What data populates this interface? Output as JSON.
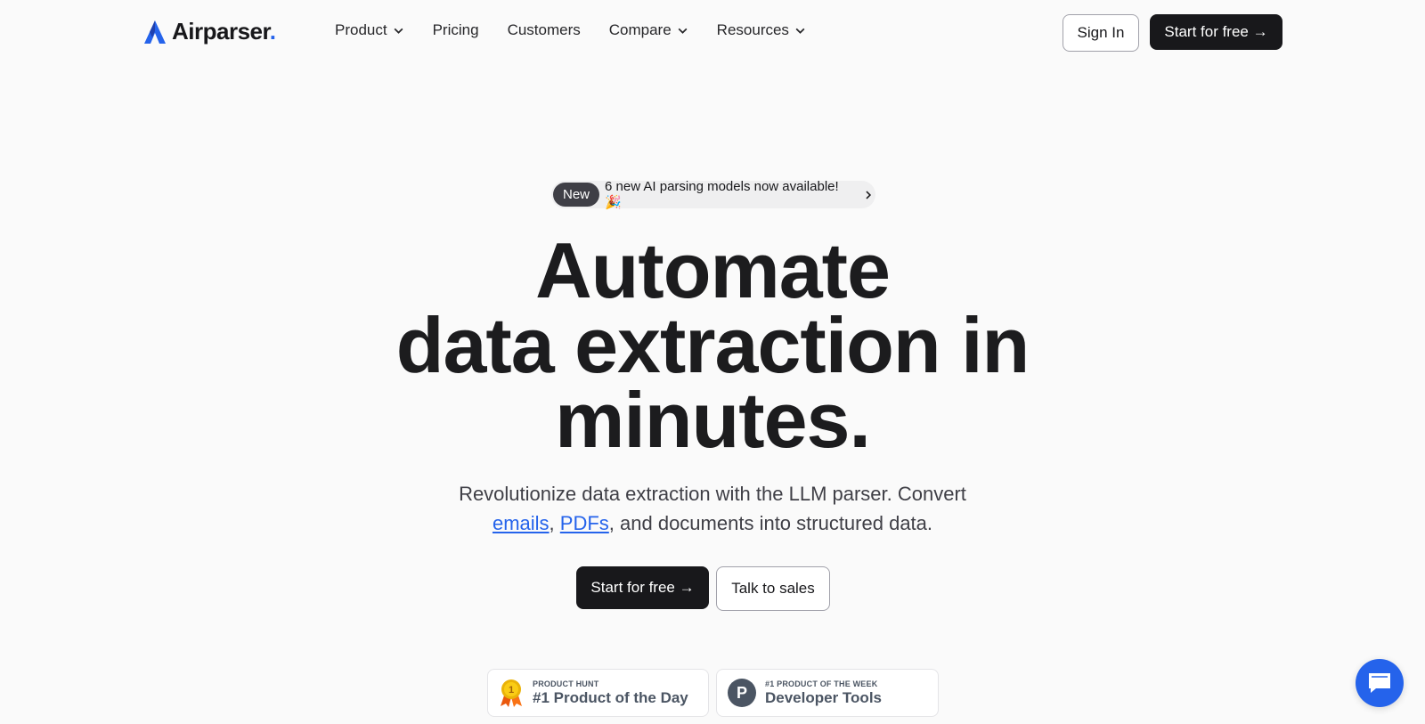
{
  "nav": {
    "logo_text": "Airparser",
    "logo_dot": ".",
    "items": [
      {
        "label": "Product",
        "has_dropdown": true
      },
      {
        "label": "Pricing",
        "has_dropdown": false
      },
      {
        "label": "Customers",
        "has_dropdown": false
      },
      {
        "label": "Compare",
        "has_dropdown": true
      },
      {
        "label": "Resources",
        "has_dropdown": true
      }
    ],
    "sign_in": "Sign In",
    "start_free": "Start for free →"
  },
  "announcement": {
    "badge": "New",
    "text": "6 new AI parsing models now available! 🎉"
  },
  "hero": {
    "line1": "Automate",
    "line2": "data extraction in",
    "line3": "minutes.",
    "subtitle_before": "Revolutionize data extraction with the LLM parser. Convert",
    "link_emails": "emails",
    "comma": ",",
    "link_pdfs": "PDFs",
    "subtitle_after": ", and documents into structured data.",
    "cta_primary": "Start for free →",
    "cta_secondary": "Talk to sales"
  },
  "badges": {
    "product_hunt": {
      "small": "PRODUCT HUNT",
      "big": "#1 Product of the Day",
      "medal_number": "1"
    },
    "dev_tools": {
      "small": "#1 PRODUCT OF THE WEEK",
      "big": "Developer Tools",
      "letter": "P"
    }
  },
  "colors": {
    "accent": "#2563eb",
    "dark": "#18181b",
    "background": "#fafafa"
  },
  "icons": {
    "chevron": "chevron-down-icon",
    "chat": "chat-bubble-icon",
    "medal": "medal-icon"
  }
}
